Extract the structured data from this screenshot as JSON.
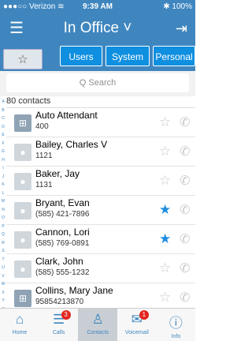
{
  "statusbar": {
    "carrier": "●●●○○ Verizon ≋",
    "time": "9:39 AM",
    "battery": "✱ 100%"
  },
  "header": {
    "title": "In Office ˅",
    "menu_icon": "hamburger-icon",
    "logout_icon": "logout-icon"
  },
  "filters": {
    "favorites": "☆",
    "users": "Users",
    "system": "System",
    "personal": "Personal"
  },
  "search": {
    "placeholder": "Q  Search"
  },
  "contacts": {
    "count_label": "80 contacts",
    "items": [
      {
        "name": "Auto Attendant",
        "number": "400",
        "favorite": false,
        "type": "system"
      },
      {
        "name": "Bailey, Charles V",
        "number": "1121",
        "favorite": false,
        "type": "user"
      },
      {
        "name": "Baker, Jay",
        "number": "1131",
        "favorite": false,
        "type": "user"
      },
      {
        "name": "Bryant, Evan",
        "number": "(585) 421-7896",
        "favorite": true,
        "type": "user"
      },
      {
        "name": "Cannon, Lori",
        "number": "(585) 769-0891",
        "favorite": true,
        "type": "user"
      },
      {
        "name": "Clark, John",
        "number": "(585) 555-1232",
        "favorite": false,
        "type": "user"
      },
      {
        "name": "Collins, Mary Jane",
        "number": "95854213870",
        "favorite": false,
        "type": "system"
      }
    ]
  },
  "alphabet": [
    "A",
    "B",
    "C",
    "D",
    "E",
    "F",
    "G",
    "H",
    "I",
    "J",
    "K",
    "L",
    "M",
    "N",
    "O",
    "P",
    "Q",
    "R",
    "S",
    "T",
    "U",
    "V",
    "W",
    "X",
    "Y",
    "Z",
    "#"
  ],
  "tabs": [
    {
      "label": "Home",
      "icon": "home-icon",
      "badge": ""
    },
    {
      "label": "Calls",
      "icon": "calls-icon",
      "badge": "3"
    },
    {
      "label": "Contacts",
      "icon": "contacts-icon",
      "badge": ""
    },
    {
      "label": "Voicemail",
      "icon": "voicemail-icon",
      "badge": "1"
    },
    {
      "label": "Info",
      "icon": "info-icon",
      "badge": ""
    }
  ],
  "colors": {
    "brand": "#3f86bf",
    "accent": "#1e8de0",
    "badge": "#e2261f"
  }
}
